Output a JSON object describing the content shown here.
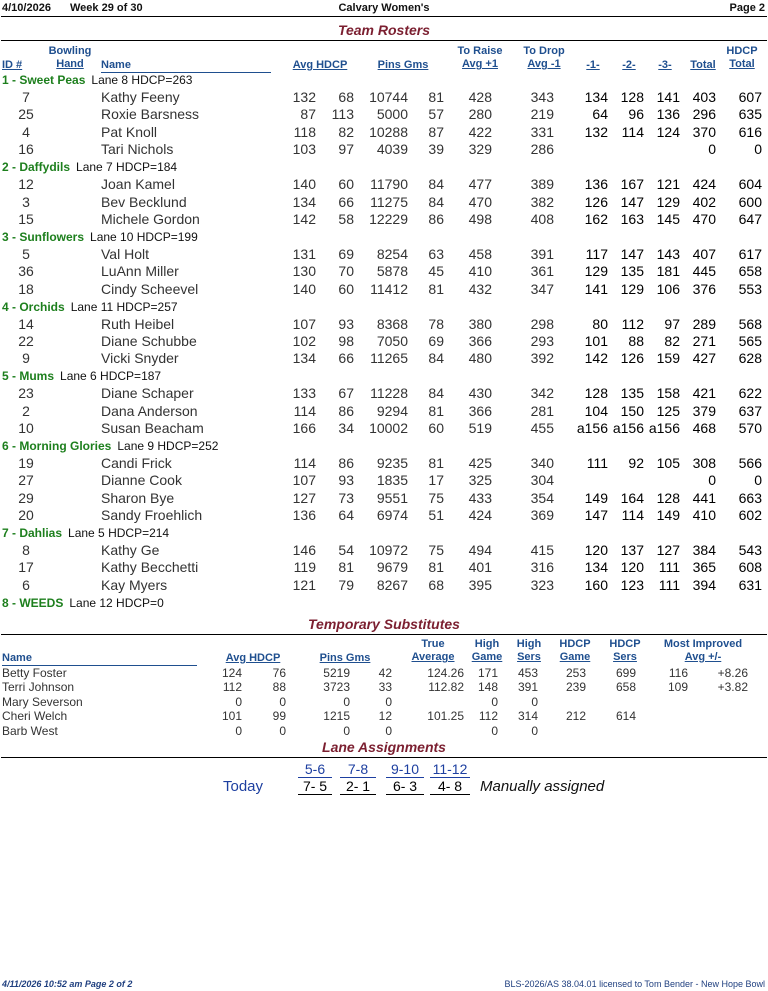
{
  "header": {
    "date": "4/10/2026",
    "week": "Week 29 of 30",
    "league": "Calvary Women's",
    "page": "Page 2"
  },
  "rosters": {
    "title": "Team Rosters",
    "columns": {
      "id": "ID #",
      "hand1": "Bowling",
      "hand2": "Hand",
      "name": "Name",
      "avg_hdcp": "Avg HDCP",
      "pins_gms": "Pins  Gms",
      "raise1": "To Raise",
      "raise2": "Avg +1",
      "drop1": "To Drop",
      "drop2": "Avg -1",
      "g1": "-1-",
      "g2": "-2-",
      "g3": "-3-",
      "total": "Total",
      "hdcp_total1": "HDCP",
      "hdcp_total2": "Total"
    },
    "teams": [
      {
        "name": "1 - Sweet Peas",
        "info": "Lane 8  HDCP=263",
        "bowlers": [
          {
            "id": "7",
            "name": "Kathy Feeny",
            "avg": "132",
            "hdcp": "68",
            "pins": "10744",
            "gms": "81",
            "raise": "428",
            "drop": "343",
            "g1": "134",
            "g2": "128",
            "g3": "141",
            "total": "403",
            "htotal": "607"
          },
          {
            "id": "25",
            "name": "Roxie Barsness",
            "avg": "87",
            "hdcp": "113",
            "pins": "5000",
            "gms": "57",
            "raise": "280",
            "drop": "219",
            "g1": "64",
            "g2": "96",
            "g3": "136",
            "total": "296",
            "htotal": "635"
          },
          {
            "id": "4",
            "name": "Pat Knoll",
            "avg": "118",
            "hdcp": "82",
            "pins": "10288",
            "gms": "87",
            "raise": "422",
            "drop": "331",
            "g1": "132",
            "g2": "114",
            "g3": "124",
            "total": "370",
            "htotal": "616"
          },
          {
            "id": "16",
            "name": "Tari Nichols",
            "avg": "103",
            "hdcp": "97",
            "pins": "4039",
            "gms": "39",
            "raise": "329",
            "drop": "286",
            "g1": "",
            "g2": "",
            "g3": "",
            "total": "0",
            "htotal": "0"
          }
        ]
      },
      {
        "name": "2 - Daffydils",
        "info": "Lane 7  HDCP=184",
        "bowlers": [
          {
            "id": "12",
            "name": "Joan Kamel",
            "avg": "140",
            "hdcp": "60",
            "pins": "11790",
            "gms": "84",
            "raise": "477",
            "drop": "389",
            "g1": "136",
            "g2": "167",
            "g3": "121",
            "total": "424",
            "htotal": "604"
          },
          {
            "id": "3",
            "name": "Bev Becklund",
            "avg": "134",
            "hdcp": "66",
            "pins": "11275",
            "gms": "84",
            "raise": "470",
            "drop": "382",
            "g1": "126",
            "g2": "147",
            "g3": "129",
            "total": "402",
            "htotal": "600"
          },
          {
            "id": "15",
            "name": "Michele Gordon",
            "avg": "142",
            "hdcp": "58",
            "pins": "12229",
            "gms": "86",
            "raise": "498",
            "drop": "408",
            "g1": "162",
            "g2": "163",
            "g3": "145",
            "total": "470",
            "htotal": "647"
          }
        ]
      },
      {
        "name": "3 - Sunflowers",
        "info": "Lane 10  HDCP=199",
        "bowlers": [
          {
            "id": "5",
            "name": "Val Holt",
            "avg": "131",
            "hdcp": "69",
            "pins": "8254",
            "gms": "63",
            "raise": "458",
            "drop": "391",
            "g1": "117",
            "g2": "147",
            "g3": "143",
            "total": "407",
            "htotal": "617"
          },
          {
            "id": "36",
            "name": "LuAnn Miller",
            "avg": "130",
            "hdcp": "70",
            "pins": "5878",
            "gms": "45",
            "raise": "410",
            "drop": "361",
            "g1": "129",
            "g2": "135",
            "g3": "181",
            "total": "445",
            "htotal": "658"
          },
          {
            "id": "18",
            "name": "Cindy Scheevel",
            "avg": "140",
            "hdcp": "60",
            "pins": "11412",
            "gms": "81",
            "raise": "432",
            "drop": "347",
            "g1": "141",
            "g2": "129",
            "g3": "106",
            "total": "376",
            "htotal": "553"
          }
        ]
      },
      {
        "name": "4 - Orchids",
        "info": "Lane 11  HDCP=257",
        "bowlers": [
          {
            "id": "14",
            "name": "Ruth Heibel",
            "avg": "107",
            "hdcp": "93",
            "pins": "8368",
            "gms": "78",
            "raise": "380",
            "drop": "298",
            "g1": "80",
            "g2": "112",
            "g3": "97",
            "total": "289",
            "htotal": "568"
          },
          {
            "id": "22",
            "name": "Diane Schubbe",
            "avg": "102",
            "hdcp": "98",
            "pins": "7050",
            "gms": "69",
            "raise": "366",
            "drop": "293",
            "g1": "101",
            "g2": "88",
            "g3": "82",
            "total": "271",
            "htotal": "565"
          },
          {
            "id": "9",
            "name": "Vicki Snyder",
            "avg": "134",
            "hdcp": "66",
            "pins": "11265",
            "gms": "84",
            "raise": "480",
            "drop": "392",
            "g1": "142",
            "g2": "126",
            "g3": "159",
            "total": "427",
            "htotal": "628"
          }
        ]
      },
      {
        "name": "5 - Mums",
        "info": "Lane 6  HDCP=187",
        "bowlers": [
          {
            "id": "23",
            "name": "Diane Schaper",
            "avg": "133",
            "hdcp": "67",
            "pins": "11228",
            "gms": "84",
            "raise": "430",
            "drop": "342",
            "g1": "128",
            "g2": "135",
            "g3": "158",
            "total": "421",
            "htotal": "622"
          },
          {
            "id": "2",
            "name": "Dana Anderson",
            "avg": "114",
            "hdcp": "86",
            "pins": "9294",
            "gms": "81",
            "raise": "366",
            "drop": "281",
            "g1": "104",
            "g2": "150",
            "g3": "125",
            "total": "379",
            "htotal": "637"
          },
          {
            "id": "10",
            "name": "Susan Beacham",
            "avg": "166",
            "hdcp": "34",
            "pins": "10002",
            "gms": "60",
            "raise": "519",
            "drop": "455",
            "g1": "a156",
            "g2": "a156",
            "g3": "a156",
            "total": "468",
            "htotal": "570"
          }
        ]
      },
      {
        "name": "6 - Morning Glories",
        "info": "Lane 9  HDCP=252",
        "bowlers": [
          {
            "id": "19",
            "name": "Candi Frick",
            "avg": "114",
            "hdcp": "86",
            "pins": "9235",
            "gms": "81",
            "raise": "425",
            "drop": "340",
            "g1": "111",
            "g2": "92",
            "g3": "105",
            "total": "308",
            "htotal": "566"
          },
          {
            "id": "27",
            "name": "Dianne Cook",
            "avg": "107",
            "hdcp": "93",
            "pins": "1835",
            "gms": "17",
            "raise": "325",
            "drop": "304",
            "g1": "",
            "g2": "",
            "g3": "",
            "total": "0",
            "htotal": "0"
          },
          {
            "id": "29",
            "name": "Sharon Bye",
            "avg": "127",
            "hdcp": "73",
            "pins": "9551",
            "gms": "75",
            "raise": "433",
            "drop": "354",
            "g1": "149",
            "g2": "164",
            "g3": "128",
            "total": "441",
            "htotal": "663"
          },
          {
            "id": "20",
            "name": "Sandy Froehlich",
            "avg": "136",
            "hdcp": "64",
            "pins": "6974",
            "gms": "51",
            "raise": "424",
            "drop": "369",
            "g1": "147",
            "g2": "114",
            "g3": "149",
            "total": "410",
            "htotal": "602"
          }
        ]
      },
      {
        "name": "7 - Dahlias",
        "info": "Lane 5  HDCP=214",
        "bowlers": [
          {
            "id": "8",
            "name": "Kathy Ge",
            "avg": "146",
            "hdcp": "54",
            "pins": "10972",
            "gms": "75",
            "raise": "494",
            "drop": "415",
            "g1": "120",
            "g2": "137",
            "g3": "127",
            "total": "384",
            "htotal": "543"
          },
          {
            "id": "17",
            "name": "Kathy Becchetti",
            "avg": "119",
            "hdcp": "81",
            "pins": "9679",
            "gms": "81",
            "raise": "401",
            "drop": "316",
            "g1": "134",
            "g2": "120",
            "g3": "111",
            "total": "365",
            "htotal": "608"
          },
          {
            "id": "6",
            "name": "Kay Myers",
            "avg": "121",
            "hdcp": "79",
            "pins": "8267",
            "gms": "68",
            "raise": "395",
            "drop": "323",
            "g1": "160",
            "g2": "123",
            "g3": "111",
            "total": "394",
            "htotal": "631"
          }
        ]
      },
      {
        "name": "8 - WEEDS",
        "info": "Lane 12  HDCP=0",
        "bowlers": []
      }
    ]
  },
  "substitutes": {
    "title": "Temporary Substitutes",
    "columns": {
      "name": "Name",
      "avg_hdcp": "Avg HDCP",
      "pins_gms": "Pins  Gms",
      "true1": "True",
      "true2": "Average",
      "hg1": "High",
      "hg2": "Game",
      "hs1": "High",
      "hs2": "Sers",
      "hdg1": "HDCP",
      "hdg2": "Game",
      "hds1": "HDCP",
      "hds2": "Sers",
      "mi1": "Most Improved",
      "mi2": "Avg    +/-"
    },
    "rows": [
      {
        "name": "Betty Foster",
        "avg": "124",
        "hdcp": "76",
        "pins": "5219",
        "gms": "42",
        "true_avg": "124.26",
        "hgame": "171",
        "hsers": "453",
        "hdgame": "253",
        "hdsers": "699",
        "mi_avg": "116",
        "mi_diff": "+8.26"
      },
      {
        "name": "Terri Johnson",
        "avg": "112",
        "hdcp": "88",
        "pins": "3723",
        "gms": "33",
        "true_avg": "112.82",
        "hgame": "148",
        "hsers": "391",
        "hdgame": "239",
        "hdsers": "658",
        "mi_avg": "109",
        "mi_diff": "+3.82"
      },
      {
        "name": "Mary Severson",
        "avg": "0",
        "hdcp": "0",
        "pins": "0",
        "gms": "0",
        "true_avg": "",
        "hgame": "0",
        "hsers": "0",
        "hdgame": "",
        "hdsers": "",
        "mi_avg": "",
        "mi_diff": ""
      },
      {
        "name": "Cheri Welch",
        "avg": "101",
        "hdcp": "99",
        "pins": "1215",
        "gms": "12",
        "true_avg": "101.25",
        "hgame": "112",
        "hsers": "314",
        "hdgame": "212",
        "hdsers": "614",
        "mi_avg": "",
        "mi_diff": ""
      },
      {
        "name": "Barb West",
        "avg": "0",
        "hdcp": "0",
        "pins": "0",
        "gms": "0",
        "true_avg": "",
        "hgame": "0",
        "hsers": "0",
        "hdgame": "",
        "hdsers": "",
        "mi_avg": "",
        "mi_diff": ""
      }
    ]
  },
  "lanes": {
    "title": "Lane Assignments",
    "label": "Today",
    "pairs": [
      "5-6",
      "7-8",
      "9-10",
      "11-12"
    ],
    "matchups": [
      "7- 5",
      "2- 1",
      "6- 3",
      "4- 8"
    ],
    "note": "Manually assigned"
  },
  "footer": {
    "printed": "4/11/2026  10:52 am   Page 2 of 2",
    "license": "BLS-2026/AS 38.04.01 licensed to Tom Bender - New Hope Bowl"
  }
}
